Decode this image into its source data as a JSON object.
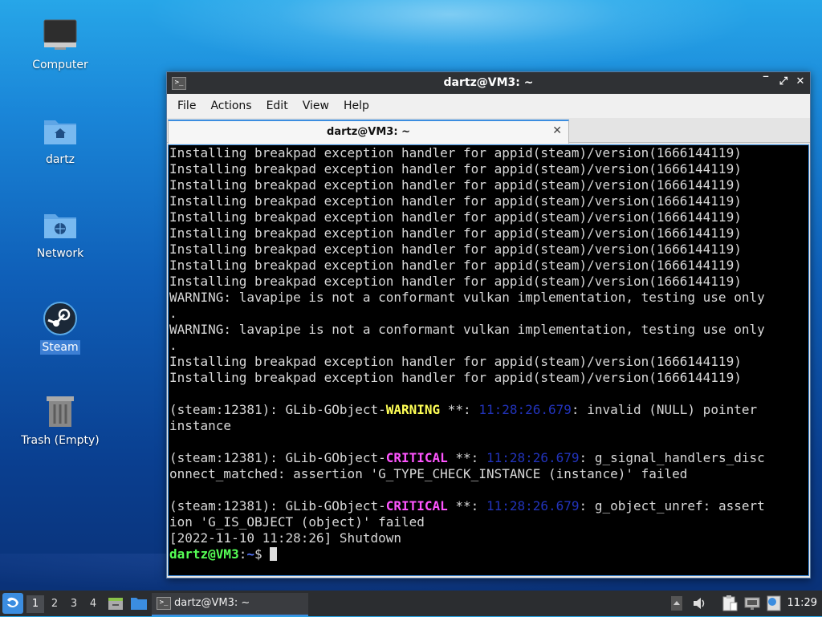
{
  "desktop": {
    "icons": [
      {
        "label": "Computer",
        "icon": "monitor-icon"
      },
      {
        "label": "dartz",
        "icon": "home-folder-icon"
      },
      {
        "label": "Network",
        "icon": "network-folder-icon"
      },
      {
        "label": "Steam",
        "icon": "steam-icon",
        "selected": true
      },
      {
        "label": "Trash (Empty)",
        "icon": "trash-icon"
      }
    ]
  },
  "window": {
    "title": "dartz@VM3: ~",
    "app_icon_glyph": ">_",
    "controls": {
      "minimize": "‾",
      "maximize": "⤢",
      "close": "✕"
    },
    "menu": [
      "File",
      "Actions",
      "Edit",
      "View",
      "Help"
    ],
    "tab": {
      "label": "dartz@VM3: ~",
      "close": "✕"
    }
  },
  "terminal": {
    "lines": [
      [
        {
          "t": "Installing breakpad exception handler for appid(steam)/version(1666144119)"
        }
      ],
      [
        {
          "t": "Installing breakpad exception handler for appid(steam)/version(1666144119)"
        }
      ],
      [
        {
          "t": "Installing breakpad exception handler for appid(steam)/version(1666144119)"
        }
      ],
      [
        {
          "t": "Installing breakpad exception handler for appid(steam)/version(1666144119)"
        }
      ],
      [
        {
          "t": "Installing breakpad exception handler for appid(steam)/version(1666144119)"
        }
      ],
      [
        {
          "t": "Installing breakpad exception handler for appid(steam)/version(1666144119)"
        }
      ],
      [
        {
          "t": "Installing breakpad exception handler for appid(steam)/version(1666144119)"
        }
      ],
      [
        {
          "t": "Installing breakpad exception handler for appid(steam)/version(1666144119)"
        }
      ],
      [
        {
          "t": "Installing breakpad exception handler for appid(steam)/version(1666144119)"
        }
      ],
      [
        {
          "t": "WARNING: lavapipe is not a conformant vulkan implementation, testing use only"
        }
      ],
      [
        {
          "t": "."
        }
      ],
      [
        {
          "t": "WARNING: lavapipe is not a conformant vulkan implementation, testing use only"
        }
      ],
      [
        {
          "t": "."
        }
      ],
      [
        {
          "t": "Installing breakpad exception handler for appid(steam)/version(1666144119)"
        }
      ],
      [
        {
          "t": "Installing breakpad exception handler for appid(steam)/version(1666144119)"
        }
      ],
      [
        {
          "t": ""
        }
      ],
      [
        {
          "t": "(steam:12381): GLib-GObject-"
        },
        {
          "t": "WARNING",
          "c": "warn"
        },
        {
          "t": " **: "
        },
        {
          "t": "11:28:26.679",
          "c": "ts"
        },
        {
          "t": ": invalid (NULL) pointer"
        }
      ],
      [
        {
          "t": "instance"
        }
      ],
      [
        {
          "t": ""
        }
      ],
      [
        {
          "t": "(steam:12381): GLib-GObject-"
        },
        {
          "t": "CRITICAL",
          "c": "crit"
        },
        {
          "t": " **: "
        },
        {
          "t": "11:28:26.679",
          "c": "ts"
        },
        {
          "t": ": g_signal_handlers_disc"
        }
      ],
      [
        {
          "t": "onnect_matched: assertion 'G_TYPE_CHECK_INSTANCE (instance)' failed"
        }
      ],
      [
        {
          "t": ""
        }
      ],
      [
        {
          "t": "(steam:12381): GLib-GObject-"
        },
        {
          "t": "CRITICAL",
          "c": "crit"
        },
        {
          "t": " **: "
        },
        {
          "t": "11:28:26.679",
          "c": "ts"
        },
        {
          "t": ": g_object_unref: assert"
        }
      ],
      [
        {
          "t": "ion 'G_IS_OBJECT (object)' failed"
        }
      ],
      [
        {
          "t": "[2022-11-10 11:28:26] Shutdown"
        }
      ]
    ],
    "prompt": {
      "user_host": "dartz@VM3",
      "sep": ":",
      "path": "~",
      "symbol": "$ "
    }
  },
  "taskbar": {
    "workspaces": [
      "1",
      "2",
      "3",
      "4"
    ],
    "active_workspace": "1",
    "task_label": "dartz@VM3: ~",
    "tray_icons": [
      "scroll-up-icon",
      "volume-icon",
      "clipboard-icon",
      "network-wired-icon",
      "notification-icon"
    ],
    "clock": "11:29"
  },
  "colors": {
    "accent": "#3b8de0",
    "warning": "#ffff55",
    "critical": "#ff55ff",
    "timestamp": "#2233bb",
    "prompt_user": "#55ff55",
    "prompt_path": "#5577ff"
  }
}
